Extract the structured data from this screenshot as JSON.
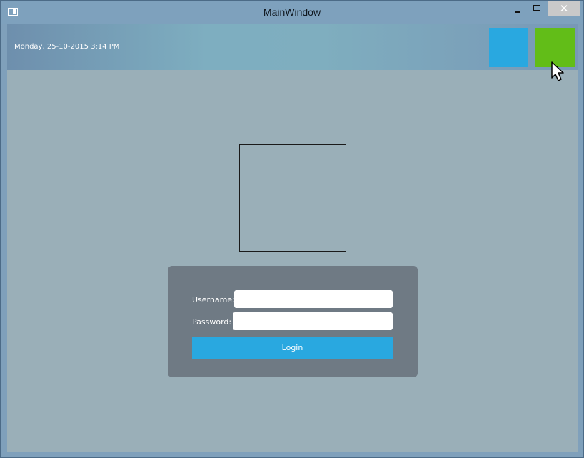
{
  "window": {
    "title": "MainWindow",
    "close_glyph": "✕",
    "icons": [
      "app-window-icon",
      "minimize-icon",
      "maximize-icon",
      "close-icon"
    ]
  },
  "header": {
    "datetime": "Monday, 25-10-2015 3:14 PM",
    "tiles": [
      {
        "name": "blue-tile",
        "color": "#29a8e0"
      },
      {
        "name": "green-tile",
        "color": "#62bd18"
      }
    ]
  },
  "login": {
    "username_label": "Username:",
    "password_label": "Password:",
    "username_value": "",
    "password_value": "",
    "login_label": "Login"
  },
  "colors": {
    "accent_blue": "#29a8e0",
    "accent_green": "#62bd18",
    "panel": "#6f7a84",
    "content_bg": "#9aafb8"
  },
  "cursor": {
    "icon": "mouse-pointer-icon"
  }
}
